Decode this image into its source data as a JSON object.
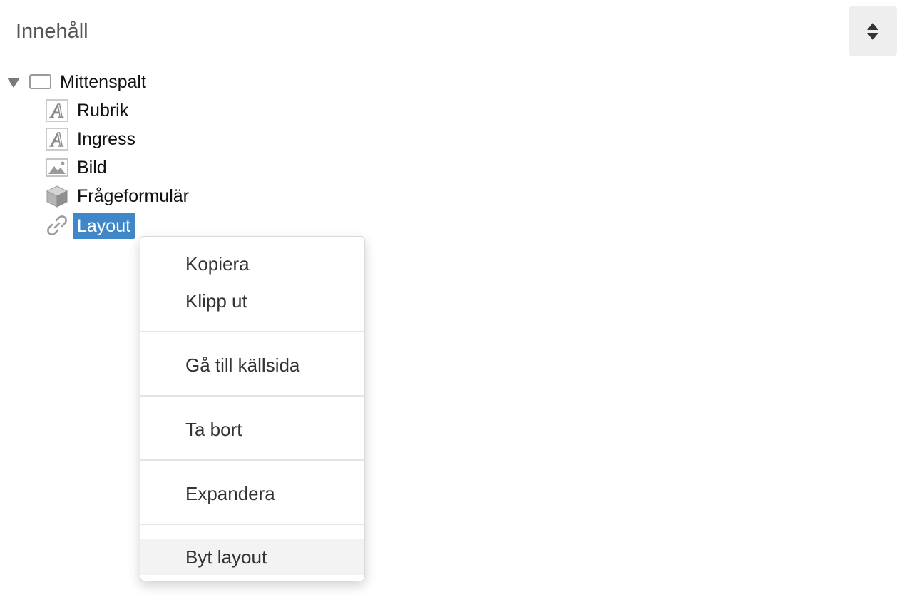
{
  "header": {
    "title": "Innehåll",
    "sort_icon": "sort-updown-icon"
  },
  "tree": {
    "root": {
      "label": "Mittenspalt",
      "expanded": true,
      "icon": "rectangle-region-icon"
    },
    "children": [
      {
        "label": "Rubrik",
        "icon": "text-a-icon"
      },
      {
        "label": "Ingress",
        "icon": "text-a-icon"
      },
      {
        "label": "Bild",
        "icon": "image-icon"
      },
      {
        "label": "Frågeformulär",
        "icon": "cube-icon"
      },
      {
        "label": "Layout",
        "icon": "link-icon",
        "selected": true
      }
    ]
  },
  "context_menu": {
    "items": [
      {
        "label": "Kopiera"
      },
      {
        "label": "Klipp ut"
      },
      {
        "label": "Gå till källsida"
      },
      {
        "label": "Ta bort"
      },
      {
        "label": "Expandera"
      },
      {
        "label": "Byt layout",
        "hovered": true
      }
    ]
  },
  "colors": {
    "selection": "#3f87c8",
    "header_text": "#555555",
    "menu_hover": "#f3f3f3",
    "icon_gray": "#9a9a9a"
  }
}
